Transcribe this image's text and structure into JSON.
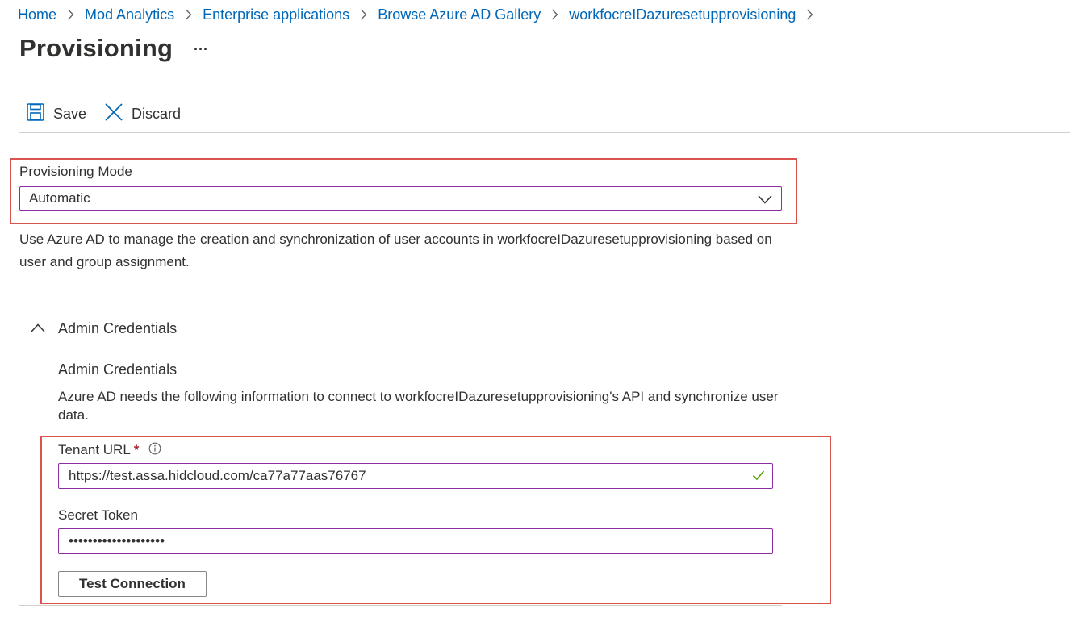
{
  "breadcrumb": {
    "items": [
      "Home",
      "Mod Analytics",
      "Enterprise applications",
      "Browse Azure AD Gallery",
      "workfocreIDazuresetupprovisioning"
    ]
  },
  "page": {
    "title": "Provisioning",
    "more_label": "···"
  },
  "toolbar": {
    "save_label": "Save",
    "discard_label": "Discard"
  },
  "provisioning_mode": {
    "label": "Provisioning Mode",
    "value": "Automatic",
    "description": "Use Azure AD to manage the creation and synchronization of user accounts in workfocreIDazuresetupprovisioning based on user and group assignment."
  },
  "admin_credentials": {
    "section_label": "Admin Credentials",
    "title": "Admin Credentials",
    "description": "Azure AD needs the following information to connect to workfocreIDazuresetupprovisioning's API and synchronize user data.",
    "tenant_url": {
      "label": "Tenant URL",
      "required_mark": "*",
      "value": "https://test.assa.hidcloud.com/ca77a77aas76767"
    },
    "secret_token": {
      "label": "Secret Token",
      "value": "••••••••••••••••••••"
    },
    "test_button_label": "Test Connection"
  },
  "colors": {
    "link": "#0067b8",
    "highlight": "#d9534f",
    "input_border": "#8a2fa2",
    "success": "#57a300",
    "required": "#a4262c"
  }
}
